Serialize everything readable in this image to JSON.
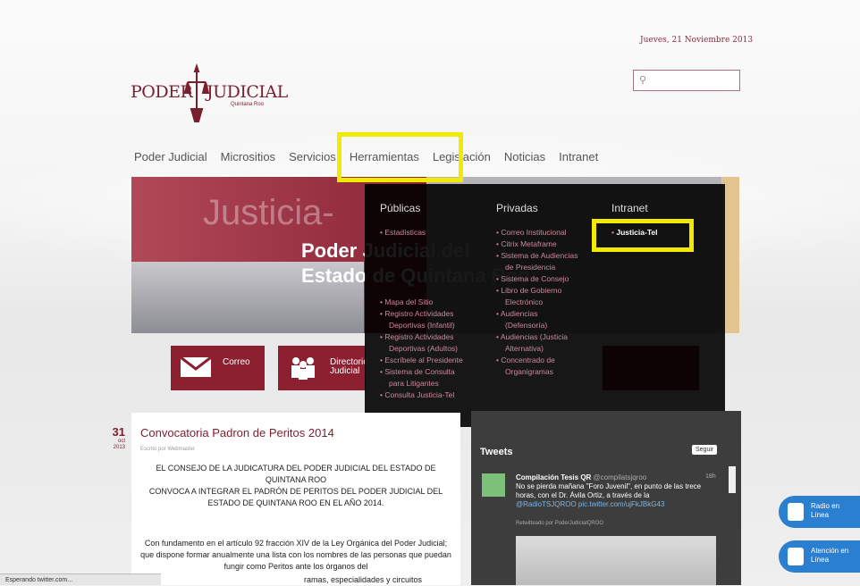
{
  "header": {
    "date": "Jueves, 21 Noviembre 2013",
    "search_icon": "search-icon",
    "logo": {
      "word1": "PODER",
      "word2": "JUDICIAL",
      "subtitle": "Quintana Roo"
    }
  },
  "nav": {
    "items": [
      "Poder Judicial",
      "Micrositios",
      "Servicios",
      "Herramientas",
      "Legislación",
      "Noticias",
      "Intranet"
    ]
  },
  "banner": {
    "title": "Justicia-",
    "line1": "Poder Judicial del",
    "line2": "Estado de Quintana Roo"
  },
  "services": {
    "correo": "Correo",
    "directorio_1": "Directorio",
    "directorio_2": "Judicial"
  },
  "dropdown": {
    "publicas": {
      "heading": "Públicas",
      "items": [
        "Estadísticas",
        "Mapa del Sitio",
        "Registro Actividades",
        "Deportivas (Infantil)",
        "Registro Actividades",
        "Deportivas (Adultos)",
        "Escríbele al Presidente",
        "Sistema de Consulta",
        "para Litigantes",
        "Consulta Justicia-Tel"
      ]
    },
    "privadas": {
      "heading": "Privadas",
      "items": [
        "Correo Institucional",
        "Citrix Metaframe",
        "Sistema de Audiencias",
        "de Presidencia",
        "Sistema de Consejo",
        "Libro de Gobierno",
        "Electrónico",
        "Audiencias",
        "(Defensoría)",
        "Audiencias (Justicia",
        "Alternativa)",
        "Concentrado de",
        "Organigramas"
      ]
    },
    "intranet": {
      "heading": "Intranet",
      "items": [
        "Justicia-Tel"
      ]
    }
  },
  "article": {
    "day": "31",
    "month": "oct",
    "year": "2013",
    "title": "Convocatoria Padron de Peritos 2014",
    "byline": "Escrito por Webmaster",
    "para1": "EL CONSEJO DE LA JUDICATURA DEL PODER JUDICIAL DEL ESTADO DE QUINTANA ROO",
    "para2": "CONVOCA A INTEGRAR EL PADRÓN DE PERITOS DEL PODER JUDICIAL DEL ESTADO DE QUINTANA ROO EN EL AÑO 2014.",
    "para3": "Con fundamento en el artículo 92 fracción XIV de la Ley Orgánica del Poder Judicial; que dispone formar anualmente una lista con los nombres de las personas que puedan fungir como Peritos ante los órganos del",
    "para4": "ramas, especialidades y circuitos"
  },
  "tweets": {
    "heading": "Tweets",
    "follow": "Seguir",
    "name": "Compilación Tesis QR",
    "handle": "@compilatsjqroo",
    "time": "18h",
    "text": "No se pierda mañana \"Foro Juvenil\", en punto de las trece horas, con el Dr. Ávila Ortiz, a través de la",
    "link": "@RadioTSJQROO pic.twitter.com/ujFkJBkG43",
    "retweet": "Retwitteado por PoderJudicialQROO"
  },
  "side": {
    "radio_1": "Radio en",
    "radio_2": "Línea",
    "atencion_1": "Atención en",
    "atencion_2": "Línea"
  },
  "status": "Esperando twitter.com...",
  "colors": {
    "brand": "#7a1f2e",
    "highlight": "#f2ea00",
    "side_button": "#2a7fd0"
  }
}
